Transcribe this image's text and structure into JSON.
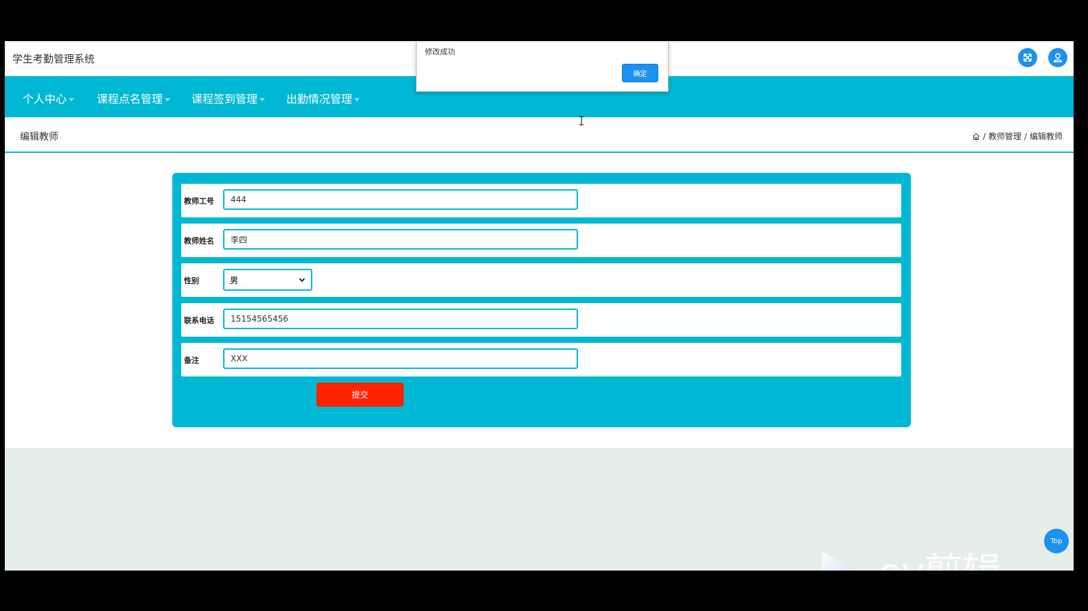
{
  "app": {
    "title": "学生考勤管理系统"
  },
  "header": {
    "fullscreen_icon": "expand-icon",
    "user_icon": "user-icon"
  },
  "nav": {
    "items": [
      {
        "label": "个人中心"
      },
      {
        "label": "课程点名管理"
      },
      {
        "label": "课程签到管理"
      },
      {
        "label": "出勤情况管理"
      }
    ]
  },
  "page": {
    "title": "编辑教师",
    "breadcrumb": [
      "教师管理",
      "编辑教师"
    ],
    "breadcrumb_separator": "/"
  },
  "form": {
    "fields": [
      {
        "label": "教师工号",
        "value": "444"
      },
      {
        "label": "教师姓名",
        "value": "李四"
      },
      {
        "label": "性别",
        "value": "男"
      },
      {
        "label": "联系电话",
        "value": "15154565456"
      },
      {
        "label": "备注",
        "value": "XXX"
      }
    ],
    "submit_label": "提交"
  },
  "alert": {
    "message": "修改成功",
    "ok_label": "确定"
  },
  "scroll_top": {
    "label": "Top"
  },
  "watermark": {
    "text": "ev剪辑"
  },
  "colors": {
    "accent": "#00b8d4",
    "primary": "#1e90f0",
    "danger": "#ff2200",
    "page_bg": "#e6eeea"
  }
}
